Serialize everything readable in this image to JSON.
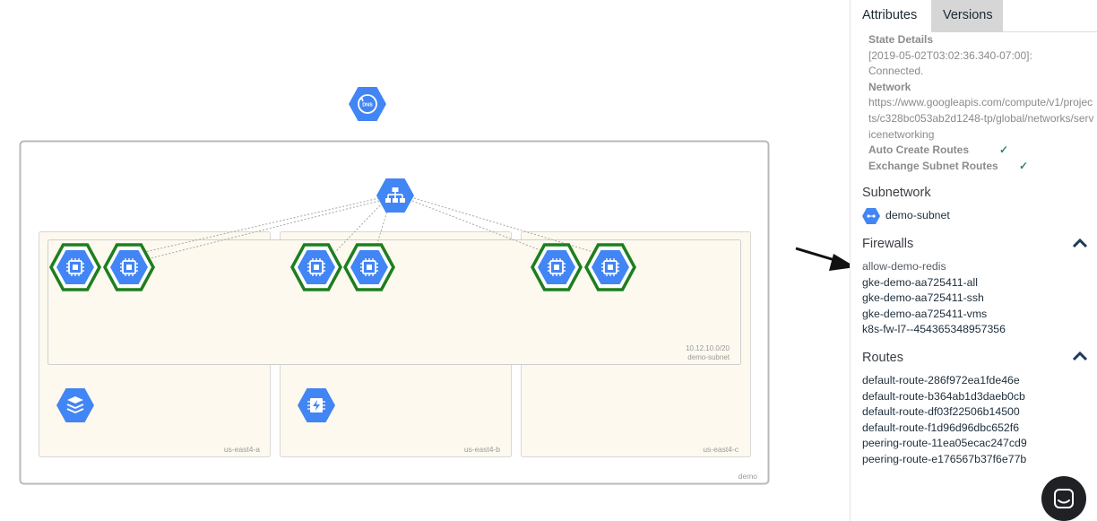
{
  "canvas": {
    "project_label": "demo",
    "zones": [
      "us-east4-a",
      "us-east4-b",
      "us-east4-c"
    ],
    "subnet_cidr": "10.12.10.0/20",
    "subnet_name": "demo-subnet",
    "dns_icon_text": "DNS",
    "colors": {
      "node_blue": "#4285f4",
      "ring_green": "#1e7e1e",
      "zone_fill": "#fdf9ef",
      "frame": "#b9b9b9"
    }
  },
  "panel": {
    "tabs": {
      "attributes": "Attributes",
      "versions": "Versions"
    },
    "state_details": {
      "label": "State Details",
      "value_line1": "[2019-05-02T03:02:36.340-07:00]:",
      "value_line2": "Connected."
    },
    "network": {
      "label": "Network",
      "value": "https://www.googleapis.com/compute/v1/projects/c328bc053ab2d1248-tp/global/networks/servicenetworking"
    },
    "auto_create_routes": {
      "label": "Auto Create Routes",
      "check": "✓"
    },
    "exchange_subnet_routes": {
      "label": "Exchange Subnet Routes",
      "check": "✓"
    },
    "subnetwork": {
      "title": "Subnetwork",
      "item": "demo-subnet"
    },
    "firewalls": {
      "title": "Firewalls",
      "items": [
        "allow-demo-redis",
        "gke-demo-aa725411-all",
        "gke-demo-aa725411-ssh",
        "gke-demo-aa725411-vms",
        "k8s-fw-l7--454365348957356"
      ]
    },
    "routes": {
      "title": "Routes",
      "items": [
        "default-route-286f972ea1fde46e",
        "default-route-b364ab1d3daeb0cb",
        "default-route-df03f22506b14500",
        "default-route-f1d96d96dbc652f6",
        "peering-route-11ea05ecac247cd9",
        "peering-route-e176567b37f6e77b"
      ]
    }
  }
}
